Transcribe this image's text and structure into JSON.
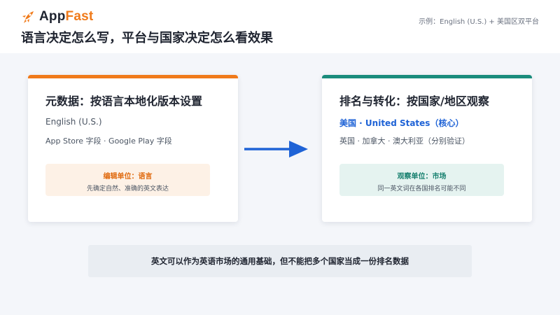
{
  "header": {
    "logo_text_a": "App",
    "logo_text_b": "Fast",
    "logo_icon": "rocket-icon",
    "example_text": "示例：English (U.S.) + 美国区双平台",
    "page_title": "语言决定怎么写，平台与国家决定怎么看效果"
  },
  "left_card": {
    "title": "元数据：按语言本地化版本设置",
    "line1": "English (U.S.)",
    "line2": "App Store 字段 · Google Play 字段",
    "box_title": "编辑单位：语言",
    "box_sub": "先确定自然、准确的英文表达"
  },
  "right_card": {
    "title": "排名与转化：按国家/地区观察",
    "line1": "美国 · United States（核心）",
    "line2": "英国 · 加拿大 · 澳大利亚（分别验证）",
    "box_title": "观察单位：市场",
    "box_sub": "同一英文词在各国排名可能不同"
  },
  "arrow_icon": "arrow-right-icon",
  "footer_note": "英文可以作为英语市场的通用基础，但不能把多个国家当成一份排名数据",
  "colors": {
    "brand_orange": "#f07a1a",
    "teal": "#1a8c7c",
    "blue": "#1f63d6"
  }
}
